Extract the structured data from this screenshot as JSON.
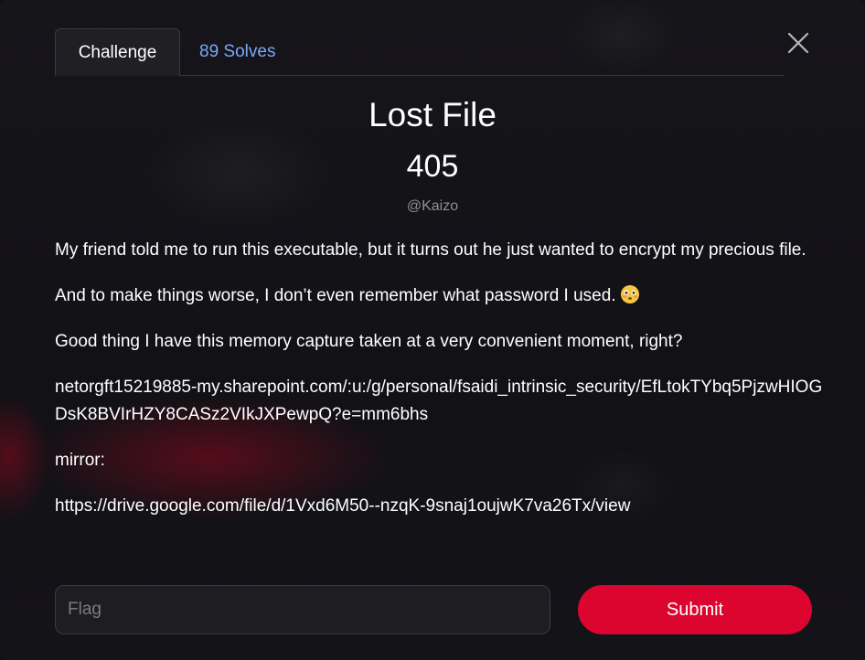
{
  "tabs": {
    "challenge_label": "Challenge",
    "solves_label": "89 Solves"
  },
  "challenge": {
    "name": "Lost File",
    "points": "405",
    "author": "@Kaizo"
  },
  "description": {
    "p1": "My friend told me to run this executable, but it turns out he just wanted to encrypt my precious file.",
    "p2": "And to make things worse, I don’t even remember what password I used.",
    "p2_emoji": "flushed-face-emoji",
    "p3": "Good thing I have this memory capture taken at a very convenient moment, right?",
    "link1": "netorgft15219885-my.sharepoint.com/:u:/g/personal/fsaidi_intrinsic_security/EfLtokTYbq5PjzwHIOGDsK8BVIrHZY8CASz2VIkJXPewpQ?e=mm6bhs",
    "mirror_label": "mirror:",
    "link2": "https://drive.google.com/file/d/1Vxd6M50--nzqK-9snaj1oujwK7va26Tx/view"
  },
  "form": {
    "flag_placeholder": "Flag",
    "flag_value": "",
    "submit_label": "Submit"
  },
  "icons": {
    "close": "close-icon"
  },
  "colors": {
    "accent": "#dc0530",
    "link_tab": "#7aa8f8",
    "background": "#141318"
  }
}
